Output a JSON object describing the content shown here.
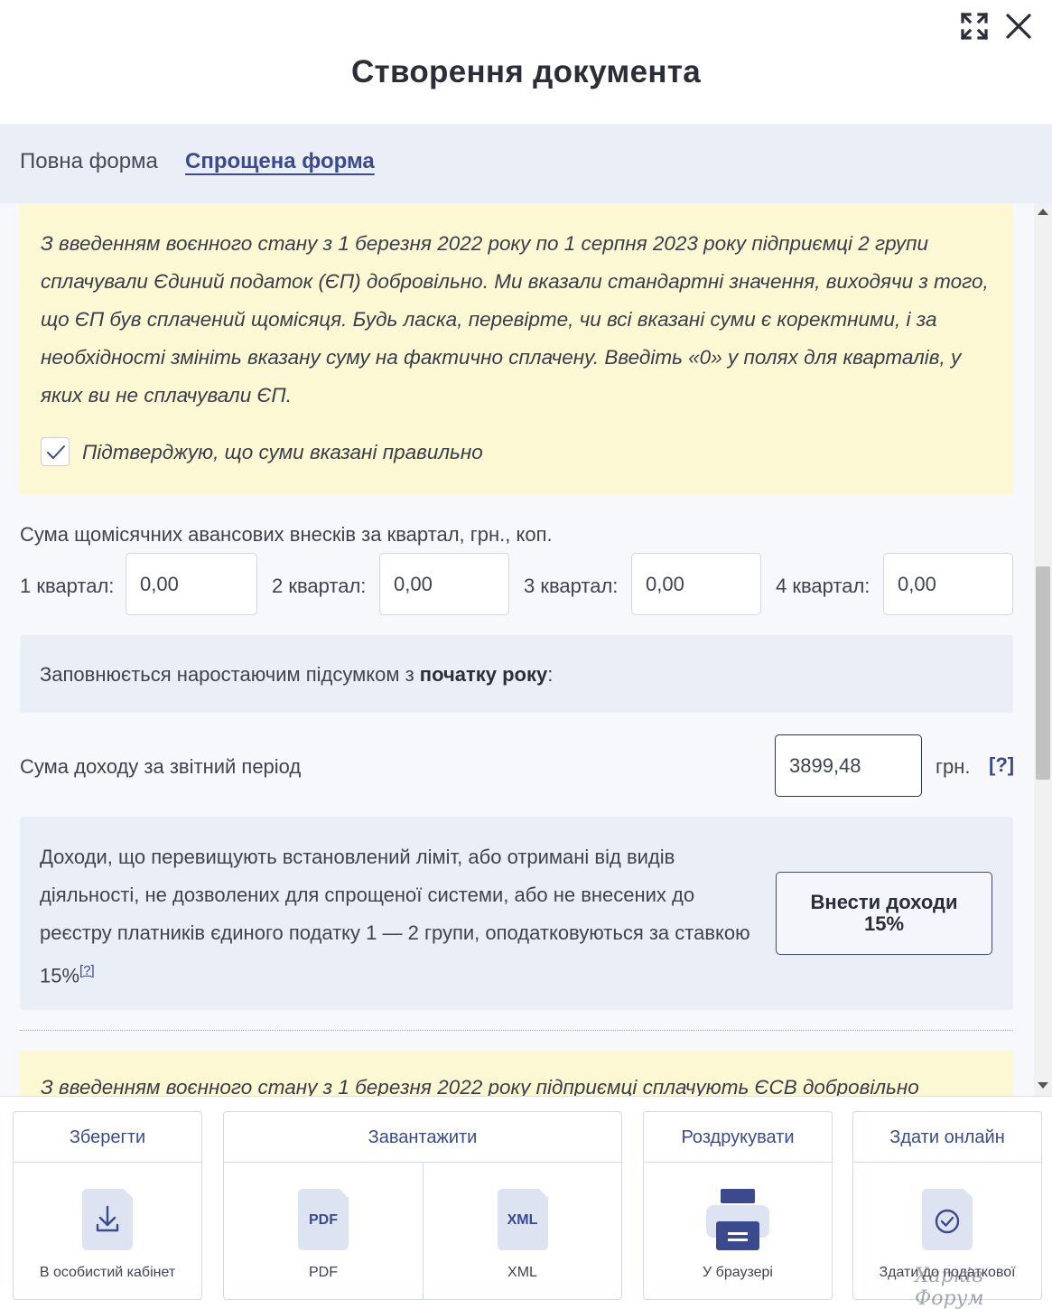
{
  "header": {
    "title": "Створення документа",
    "expand_icon": "expand-icon",
    "close_icon": "close-icon"
  },
  "tabs": [
    {
      "label": "Повна форма",
      "active": false
    },
    {
      "label": "Спрощена форма",
      "active": true
    }
  ],
  "notice1": {
    "text": "З введенням воєнного стану з 1 березня 2022 року по 1 серпня 2023 року підприємці 2 групи сплачували Єдиний податок (ЄП) добровільно. Ми вказали стандартні значення, виходячи з того, що ЄП був сплачений щомісяця. Будь ласка, перевірте, чи всі вказані суми є коректними, і за необхідності змініть вказану суму на фактично сплачену. Введіть «0» у полях для кварталів, у яких ви не сплачували ЄП.",
    "confirm_label": "Підтверджую, що суми вказані правильно",
    "confirmed": true
  },
  "quarters": {
    "title": "Сума щомісячних авансових внесків за квартал, грн., коп.",
    "items": [
      {
        "label": "1 квартал:",
        "value": "0,00"
      },
      {
        "label": "2 квартал:",
        "value": "0,00"
      },
      {
        "label": "3 квартал:",
        "value": "0,00"
      },
      {
        "label": "4 квартал:",
        "value": "0,00"
      }
    ]
  },
  "cumulative": {
    "text": "Заповнюється наростаючим підсумком з ",
    "bold": "початку року",
    "suffix": ":"
  },
  "income": {
    "label": "Сума доходу за звітний період",
    "value": "3899,48",
    "unit": "грн.",
    "help": "[?]"
  },
  "income15": {
    "text": "Доходи, що перевищують встановлений ліміт, або отримані від видів діяльності, не дозволених для спрощеної системи, або не внесених до реєстру платників єдиного податку 1 — 2 групи, оподатковуються за ставкою 15%",
    "help": "[?]",
    "button": "Внести доходи 15%"
  },
  "notice2": {
    "text": "З введенням воєнного стану з 1 березня 2022 року підприємці сплачують ЄСВ добровільно"
  },
  "footer": {
    "save": {
      "title": "Зберегти",
      "cell": "В особистий кабінет",
      "icon": "download-icon"
    },
    "download": {
      "title": "Завантажити",
      "cells": [
        {
          "label": "PDF",
          "icon_text": "PDF"
        },
        {
          "label": "XML",
          "icon_text": "XML"
        }
      ]
    },
    "print": {
      "title": "Роздрукувати",
      "cell": "У браузері",
      "icon": "printer-icon"
    },
    "submit": {
      "title": "Здати онлайн",
      "cell": "Здати до податкової",
      "icon": "check-circle-icon"
    }
  },
  "watermark": "Харків Форум",
  "colors": {
    "accent": "#3b4a8c",
    "notice_bg": "#fdf8d4",
    "info_bg": "#eaeef6",
    "icon_bg": "#dde3f1"
  }
}
